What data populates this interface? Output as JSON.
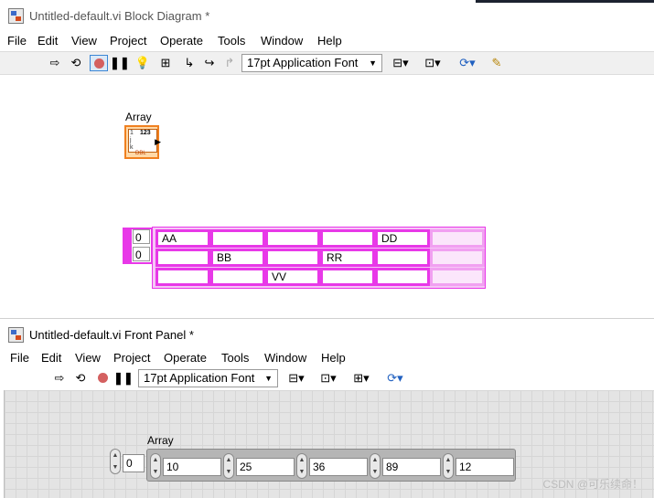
{
  "block_diagram": {
    "title": "Untitled-default.vi Block Diagram *",
    "menu": [
      "File",
      "Edit",
      "View",
      "Project",
      "Operate",
      "Tools",
      "Window",
      "Help"
    ],
    "font_dropdown": "17pt Application Font",
    "terminal": {
      "label": "Array",
      "type_badge": "DBL",
      "header_digits": "123"
    },
    "constant": {
      "indices": [
        "0",
        "0"
      ],
      "rows": [
        [
          "AA",
          "",
          "",
          "",
          "DD",
          ""
        ],
        [
          "",
          "BB",
          "",
          "RR",
          "",
          ""
        ],
        [
          "",
          "",
          "VV",
          "",
          "",
          ""
        ]
      ]
    }
  },
  "front_panel": {
    "title": "Untitled-default.vi Front Panel *",
    "menu": [
      "File",
      "Edit",
      "View",
      "Project",
      "Operate",
      "Tools",
      "Window",
      "Help"
    ],
    "font_dropdown": "17pt Application Font",
    "array": {
      "label": "Array",
      "index": "0",
      "values": [
        "10",
        "25",
        "36",
        "89",
        "12"
      ]
    }
  },
  "watermark": "CSDN @可乐续命！",
  "colors": {
    "string_wire": "#e838e8",
    "dbl_terminal": "#f08020",
    "selected_tool": "#3b86d6"
  }
}
